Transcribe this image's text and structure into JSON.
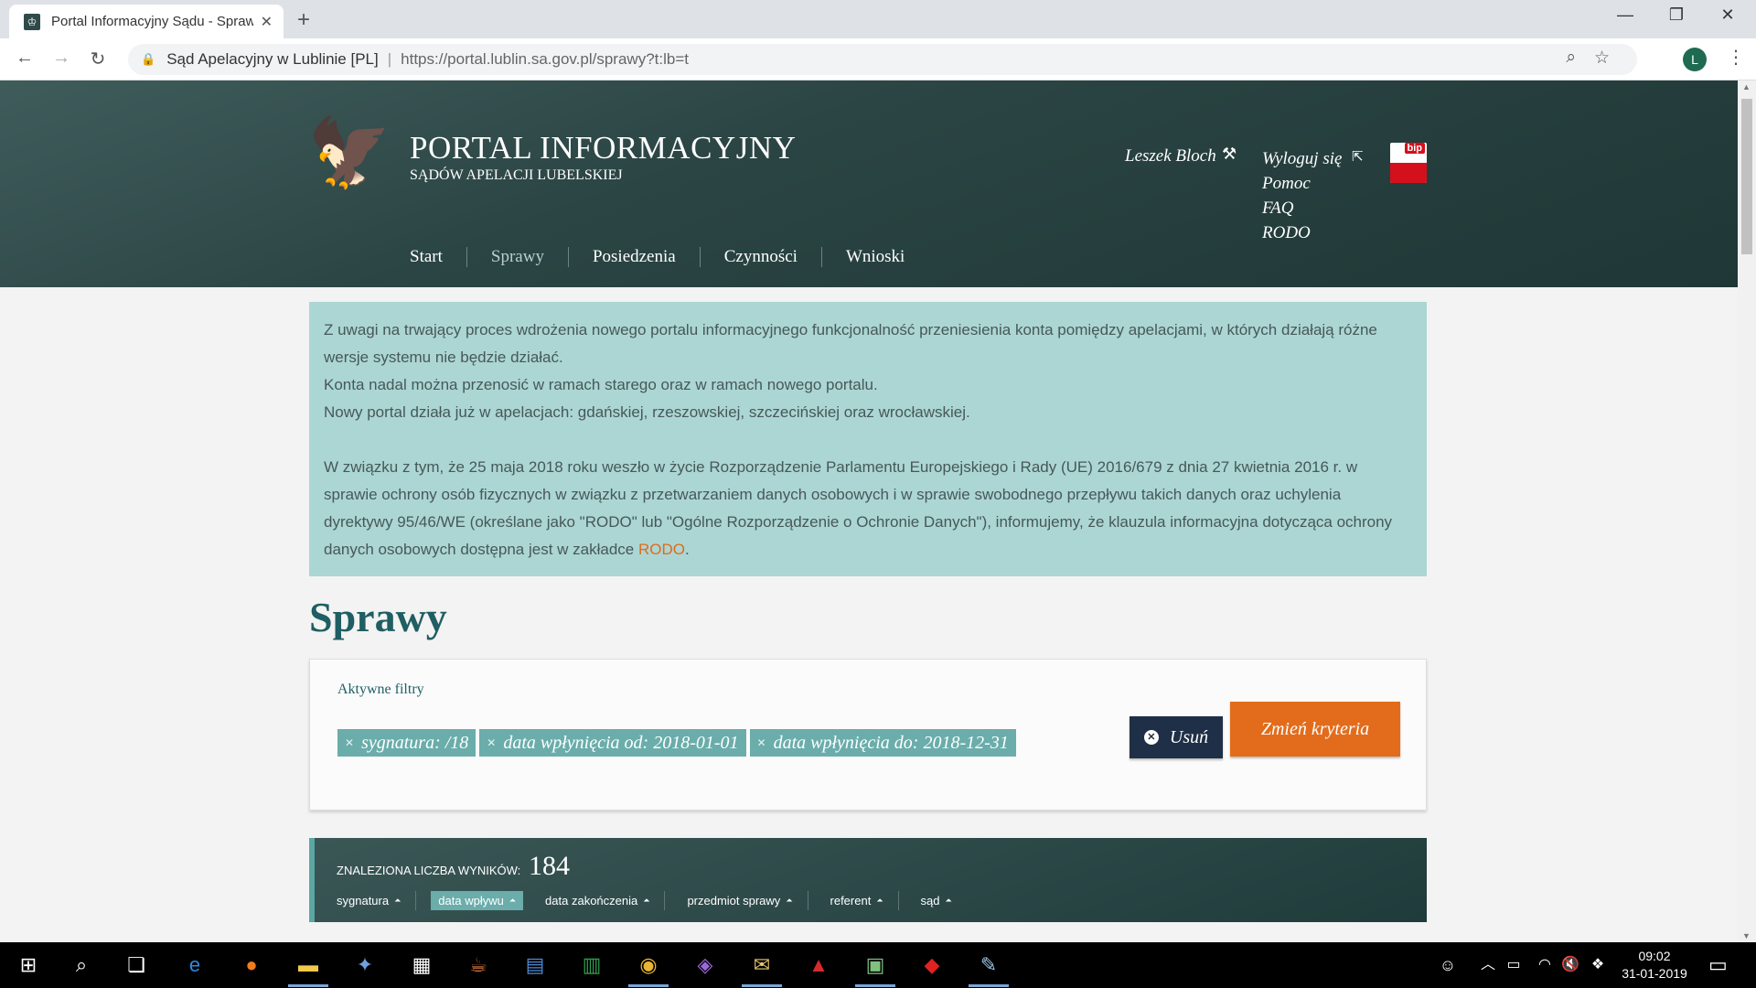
{
  "browser": {
    "tab_title": "Portal Informacyjny Sądu - Spraw",
    "site_name": "Sąd Apelacyjny w Lublinie [PL]",
    "url": "https://portal.lublin.sa.gov.pl/sprawy?t:lb=t",
    "profile_initial": "L"
  },
  "header": {
    "title": "PORTAL INFORMACYJNY",
    "subtitle": "SĄDÓW APELACJI LUBELSKIEJ",
    "user": "Leszek Bloch",
    "links": [
      "Wyloguj się",
      "Pomoc",
      "FAQ",
      "RODO"
    ],
    "bip_label": "bip"
  },
  "nav": [
    "Start",
    "Sprawy",
    "Posiedzenia",
    "Czynności",
    "Wnioski"
  ],
  "notice": {
    "p1": "Z uwagi na trwający proces wdrożenia nowego portalu informacyjnego funkcjonalność przeniesienia konta pomiędzy apelacjami, w których działają różne wersje systemu nie będzie działać.",
    "p2": "Konta nadal można przenosić w ramach starego oraz w ramach nowego portalu.",
    "p3": "Nowy portal działa już w apelacjach: gdańskiej, rzeszowskiej, szczecińskiej oraz wrocławskiej.",
    "p4": "W związku z tym, że 25 maja 2018 roku weszło w życie Rozporządzenie Parlamentu Europejskiego i Rady (UE) 2016/679 z dnia 27 kwietnia 2016 r. w sprawie ochrony osób fizycznych w związku z przetwarzaniem danych osobowych i w sprawie swobodnego przepływu takich danych oraz uchylenia dyrektywy 95/46/WE (określane jako \"RODO\" lub \"Ogólne Rozporządzenie o Ochronie Danych\"), informujemy, że klauzula informacyjna dotycząca ochrony danych osobowych dostępna jest w zakładce ",
    "link": "RODO",
    "tail": "."
  },
  "page_title": "Sprawy",
  "filters": {
    "label": "Aktywne filtry",
    "chips": [
      "sygnatura: /18",
      "data wpłynięcia od: 2018-01-01",
      "data wpłynięcia do: 2018-12-31"
    ],
    "remove_label": "Usuń",
    "change_label": "Zmień kryteria"
  },
  "results": {
    "label": "ZNALEZIONA LICZBA WYNIKÓW:",
    "count": "184",
    "sort_columns": [
      "sygnatura",
      "data wpływu",
      "data zakończenia",
      "przedmiot sprawy",
      "referent",
      "sąd"
    ]
  },
  "taskbar": {
    "time": "09:02",
    "date": "31-01-2019"
  },
  "colors": {
    "header_bg": "#2b4544",
    "notice_bg": "#acd6d3",
    "accent_orange": "#e26c1c",
    "chip_bg": "#6aadab",
    "dark_button": "#1f2f47"
  }
}
